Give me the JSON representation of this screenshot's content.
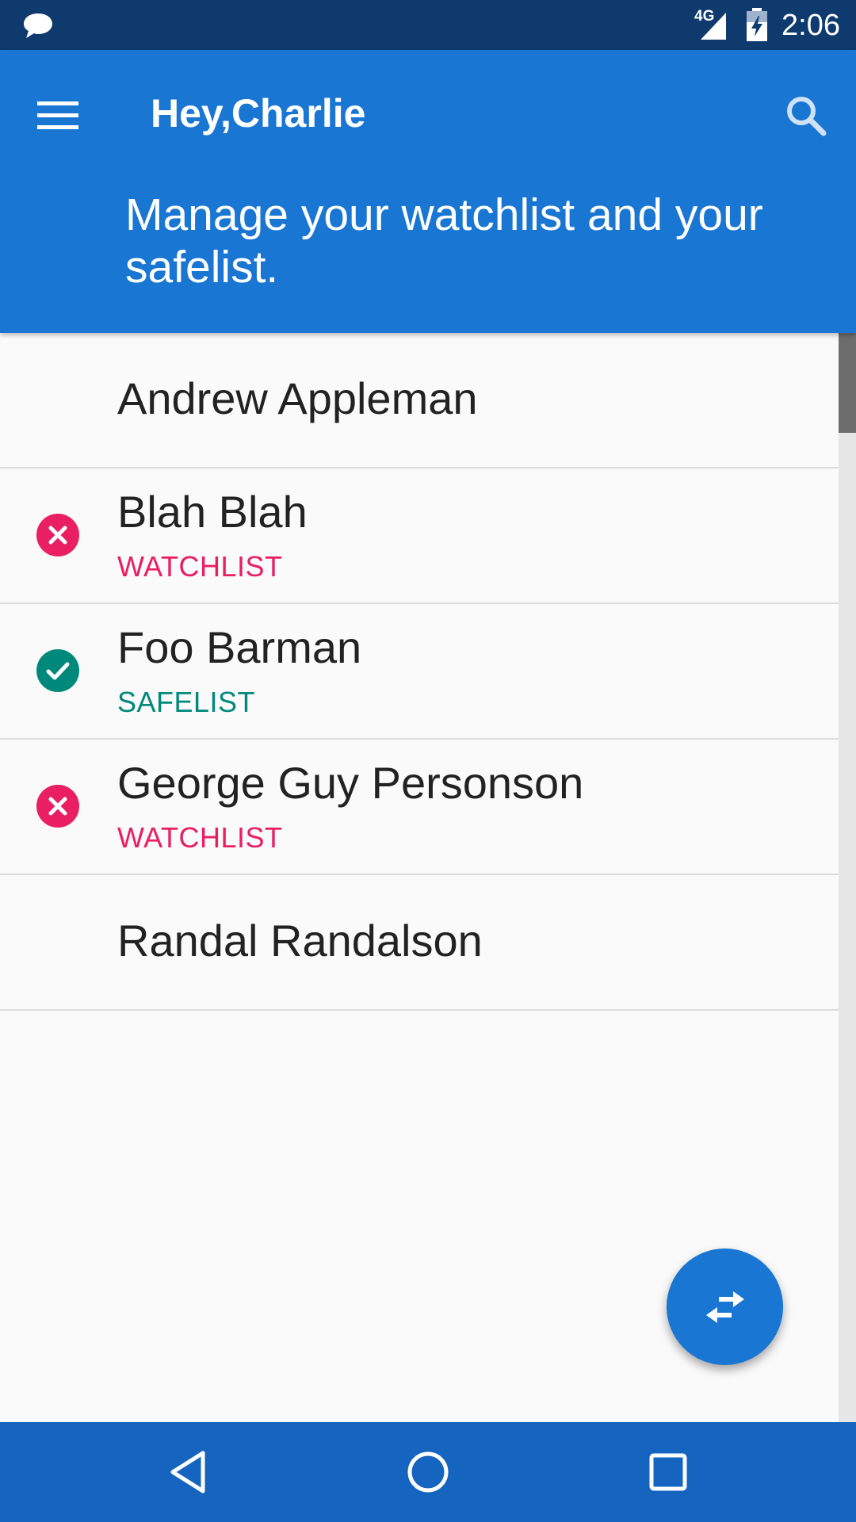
{
  "status_bar": {
    "network_type": "4G",
    "time": "2:06",
    "icons": [
      "chat-icon",
      "signal-icon",
      "battery-charging-icon"
    ]
  },
  "app_bar": {
    "title": "Hey,Charlie",
    "subtitle": "Manage your watchlist and your safelist.",
    "icons": [
      "menu-icon",
      "search-icon"
    ],
    "color": "#1976d2"
  },
  "contacts": [
    {
      "name": "Andrew Appleman",
      "tag": "",
      "status_icon": ""
    },
    {
      "name": "Blah Blah",
      "tag": "WATCHLIST",
      "status_icon": "cancel-icon"
    },
    {
      "name": "Foo Barman",
      "tag": "SAFELIST",
      "status_icon": "check-circle-icon"
    },
    {
      "name": "George Guy Personson",
      "tag": "WATCHLIST",
      "status_icon": "cancel-icon"
    },
    {
      "name": "Randal Randalson",
      "tag": "",
      "status_icon": ""
    }
  ],
  "colors": {
    "watchlist": "#e91e63",
    "safelist": "#00897b",
    "primary": "#1976d2",
    "status_bar": "#0e3a6e",
    "nav_bar": "#1565c0"
  },
  "fab": {
    "icon": "swap-horiz-icon"
  },
  "nav_bar": {
    "icons": [
      "back-icon",
      "home-icon",
      "recents-icon"
    ]
  }
}
